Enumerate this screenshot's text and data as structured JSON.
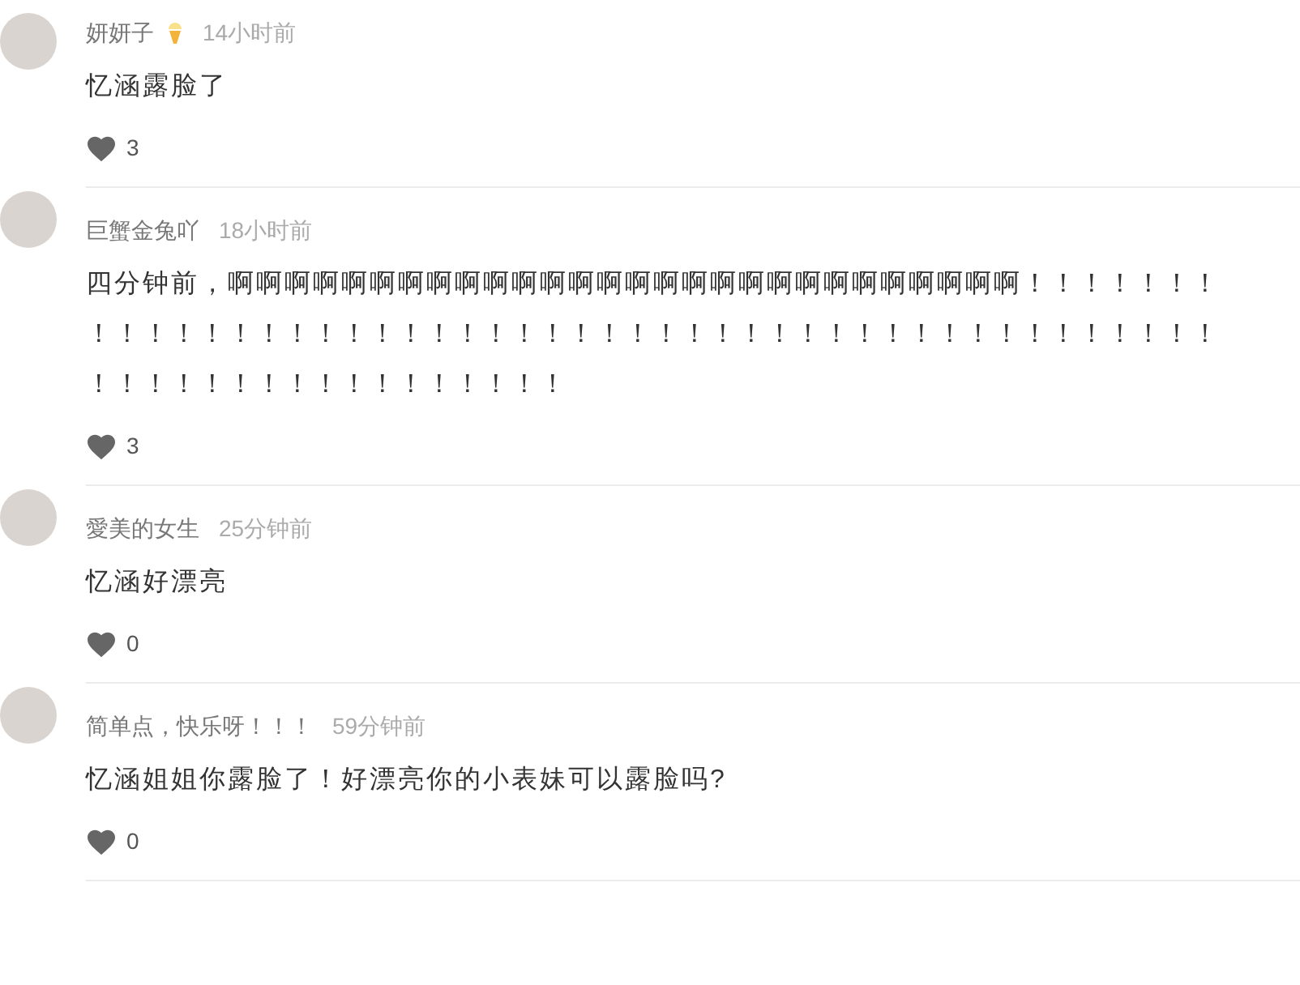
{
  "comments": [
    {
      "user": "妍妍子",
      "badge": true,
      "time": "14小时前",
      "text": "忆涵露脸了",
      "likes": "3"
    },
    {
      "user": "巨蟹金兔吖",
      "badge": false,
      "time": "18小时前",
      "text": "四分钟前，啊啊啊啊啊啊啊啊啊啊啊啊啊啊啊啊啊啊啊啊啊啊啊啊啊啊啊啊！！！！！！！！！！！！！！！！！！！！！！！！！！！！！！！！！！！！！！！！！！！！！！！！！！！！！！！！！！！！！！！！",
      "likes": "3"
    },
    {
      "user": "愛美的女生",
      "badge": false,
      "time": "25分钟前",
      "text": "忆涵好漂亮",
      "likes": "0"
    },
    {
      "user": "简单点，快乐呀！！！",
      "badge": false,
      "time": "59分钟前",
      "text": "忆涵姐姐你露脸了！好漂亮你的小表妹可以露脸吗?",
      "likes": "0"
    }
  ]
}
